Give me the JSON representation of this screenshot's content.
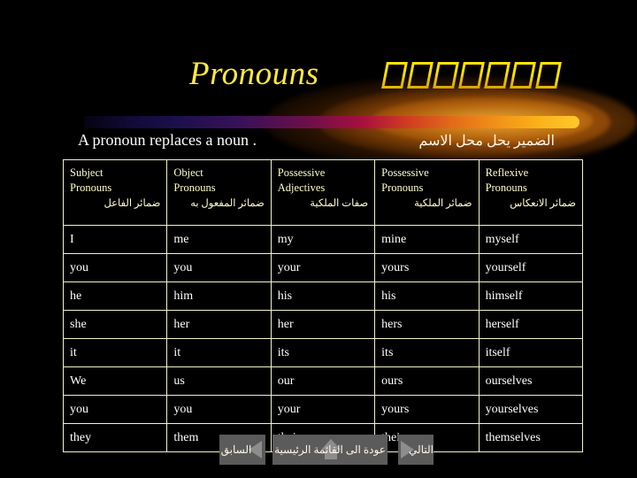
{
  "slide": {
    "background_color": "#000000",
    "title_en": "Pronouns",
    "title_ar": "الضمائر",
    "title_color": "#ffe200",
    "subtitle_en": "A pronoun replaces a noun .",
    "subtitle_ar": "الضمير يحل محل    الاسم",
    "accent_color": "#ffc72c",
    "header_text_color": "#ffffcc",
    "body_text_color": "#ffffff",
    "border_color": "#f2f2cc"
  },
  "table": {
    "headers": [
      {
        "line1": "Subject",
        "line2": "Pronouns",
        "ar": "ضمائر الفاعل"
      },
      {
        "line1": "Object",
        "line2": "Pronouns",
        "ar": "ضمائر المفعول به"
      },
      {
        "line1": "Possessive",
        "line2": "Adjectives",
        "ar": "صفات الملكية"
      },
      {
        "line1": "Possessive",
        "line2": "Pronouns",
        "ar": "ضمائر الملكية"
      },
      {
        "line1": "Reflexive",
        "line2": "Pronouns",
        "ar": "ضمائر    الانعكاس"
      }
    ],
    "rows": [
      [
        "I",
        "me",
        "my",
        "mine",
        "myself"
      ],
      [
        "you",
        "you",
        "your",
        "yours",
        "yourself"
      ],
      [
        "he",
        "him",
        "his",
        "his",
        "himself"
      ],
      [
        "she",
        "her",
        "her",
        "hers",
        "herself"
      ],
      [
        "it",
        "it",
        "its",
        "its",
        "itself"
      ],
      [
        "We",
        "us",
        "our",
        "ours",
        "ourselves"
      ],
      [
        "you",
        "you",
        "your",
        "yours",
        "yourselves"
      ],
      [
        "they",
        "them",
        "their",
        "theirs",
        "themselves"
      ]
    ]
  },
  "nav": {
    "prev_label": "السابق",
    "home_label": "عودة الى القائمة الرئيسية",
    "next_label": "التالي"
  }
}
